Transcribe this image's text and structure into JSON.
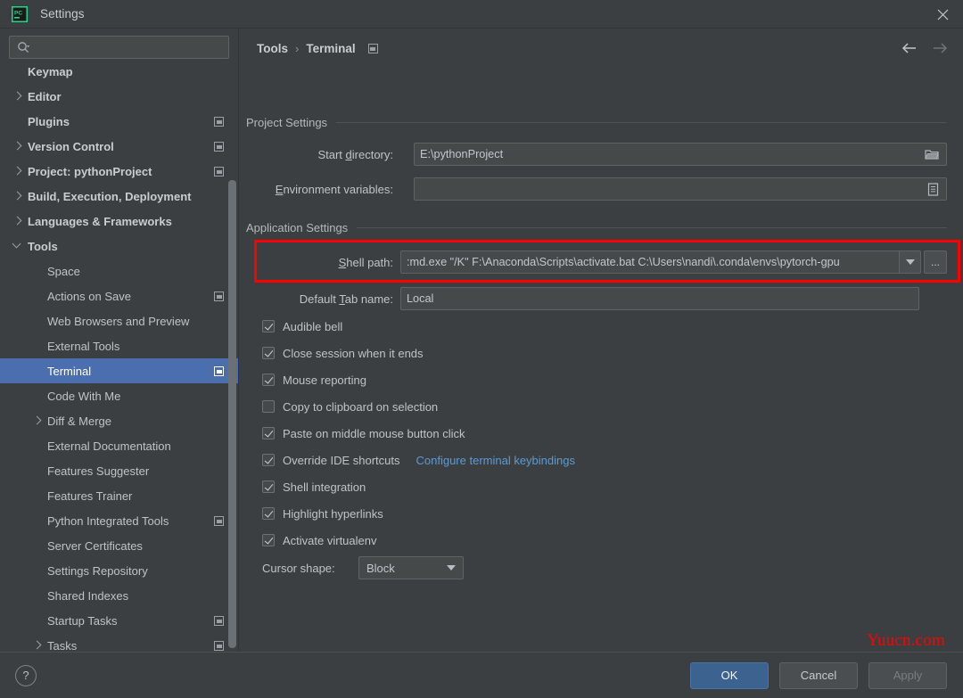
{
  "window": {
    "title": "Settings",
    "logo_icon": "pycharm-logo-icon",
    "close_icon": "close-icon"
  },
  "sidebar": {
    "search": {
      "placeholder": "",
      "value": "",
      "icon": "search-icon"
    },
    "items": [
      {
        "label": "Keymap",
        "level": 1,
        "arrow": "none",
        "bold": true,
        "mark": false,
        "selected": false
      },
      {
        "label": "Editor",
        "level": 1,
        "arrow": "right",
        "bold": true,
        "mark": false,
        "selected": false
      },
      {
        "label": "Plugins",
        "level": 1,
        "arrow": "none",
        "bold": true,
        "mark": true,
        "selected": false
      },
      {
        "label": "Version Control",
        "level": 1,
        "arrow": "right",
        "bold": true,
        "mark": true,
        "selected": false
      },
      {
        "label": "Project: pythonProject",
        "level": 1,
        "arrow": "right",
        "bold": true,
        "mark": true,
        "selected": false
      },
      {
        "label": "Build, Execution, Deployment",
        "level": 1,
        "arrow": "right",
        "bold": true,
        "mark": false,
        "selected": false
      },
      {
        "label": "Languages & Frameworks",
        "level": 1,
        "arrow": "right",
        "bold": true,
        "mark": false,
        "selected": false
      },
      {
        "label": "Tools",
        "level": 1,
        "arrow": "down",
        "bold": true,
        "mark": false,
        "selected": false
      },
      {
        "label": "Space",
        "level": 2,
        "arrow": "none",
        "bold": false,
        "mark": false,
        "selected": false
      },
      {
        "label": "Actions on Save",
        "level": 2,
        "arrow": "none",
        "bold": false,
        "mark": true,
        "selected": false
      },
      {
        "label": "Web Browsers and Preview",
        "level": 2,
        "arrow": "none",
        "bold": false,
        "mark": false,
        "selected": false
      },
      {
        "label": "External Tools",
        "level": 2,
        "arrow": "none",
        "bold": false,
        "mark": false,
        "selected": false
      },
      {
        "label": "Terminal",
        "level": 2,
        "arrow": "none",
        "bold": false,
        "mark": true,
        "selected": true
      },
      {
        "label": "Code With Me",
        "level": 2,
        "arrow": "none",
        "bold": false,
        "mark": false,
        "selected": false
      },
      {
        "label": "Diff & Merge",
        "level": 2,
        "arrow": "right",
        "bold": false,
        "mark": false,
        "selected": false
      },
      {
        "label": "External Documentation",
        "level": 2,
        "arrow": "none",
        "bold": false,
        "mark": false,
        "selected": false
      },
      {
        "label": "Features Suggester",
        "level": 2,
        "arrow": "none",
        "bold": false,
        "mark": false,
        "selected": false
      },
      {
        "label": "Features Trainer",
        "level": 2,
        "arrow": "none",
        "bold": false,
        "mark": false,
        "selected": false
      },
      {
        "label": "Python Integrated Tools",
        "level": 2,
        "arrow": "none",
        "bold": false,
        "mark": true,
        "selected": false
      },
      {
        "label": "Server Certificates",
        "level": 2,
        "arrow": "none",
        "bold": false,
        "mark": false,
        "selected": false
      },
      {
        "label": "Settings Repository",
        "level": 2,
        "arrow": "none",
        "bold": false,
        "mark": false,
        "selected": false
      },
      {
        "label": "Shared Indexes",
        "level": 2,
        "arrow": "none",
        "bold": false,
        "mark": false,
        "selected": false
      },
      {
        "label": "Startup Tasks",
        "level": 2,
        "arrow": "none",
        "bold": false,
        "mark": true,
        "selected": false
      },
      {
        "label": "Tasks",
        "level": 2,
        "arrow": "right",
        "bold": false,
        "mark": true,
        "selected": false
      }
    ]
  },
  "breadcrumb": {
    "parent": "Tools",
    "separator": "›",
    "current": "Terminal",
    "modified_mark_icon": "modified-mark-icon",
    "back_icon": "arrow-left-icon",
    "forward_icon": "arrow-right-icon"
  },
  "main": {
    "project_settings": {
      "title": "Project Settings",
      "start_directory": {
        "label_pre": "Start ",
        "label_accel": "d",
        "label_post": "irectory:",
        "value": "E:\\pythonProject",
        "browse_icon": "folder-icon"
      },
      "environment_variables": {
        "label_pre": "",
        "label_accel": "E",
        "label_post": "nvironment variables:",
        "value": "",
        "browse_icon": "list-edit-icon"
      }
    },
    "application_settings": {
      "title": "Application Settings",
      "shell_path": {
        "label_pre": "",
        "label_accel": "S",
        "label_post": "hell path:",
        "value": ":md.exe \"/K\" F:\\Anaconda\\Scripts\\activate.bat C:\\Users\\nandi\\.conda\\envs\\pytorch-gpu",
        "dropdown_icon": "chevron-down-icon",
        "browse_label": "..."
      },
      "default_tab_name": {
        "label_pre": "Default ",
        "label_accel": "T",
        "label_post": "ab name:",
        "value": "Local"
      },
      "checkboxes": [
        {
          "label": "Audible bell",
          "checked": true
        },
        {
          "label": "Close session when it ends",
          "checked": true
        },
        {
          "label": "Mouse reporting",
          "checked": true
        },
        {
          "label": "Copy to clipboard on selection",
          "checked": false
        },
        {
          "label": "Paste on middle mouse button click",
          "checked": true
        },
        {
          "label": "Override IDE shortcuts",
          "checked": true,
          "link": "Configure terminal keybindings"
        },
        {
          "label": "Shell integration",
          "checked": true
        },
        {
          "label": "Highlight hyperlinks",
          "checked": true
        },
        {
          "label": "Activate virtualenv",
          "checked": true
        }
      ],
      "cursor_shape": {
        "label": "Cursor shape:",
        "value": "Block",
        "dropdown_icon": "chevron-down-icon"
      }
    }
  },
  "footer": {
    "help_label": "?",
    "ok_label": "OK",
    "cancel_label": "Cancel",
    "apply_label": "Apply",
    "watermark": "Yuucn.com"
  },
  "colors": {
    "accent_selection": "#4b6eaf",
    "primary_button": "#3c628f",
    "link": "#5b9bd5",
    "highlight_box": "#fe0000",
    "watermark": "#ff0000",
    "background": "#3c3f41",
    "field_background": "#45494a"
  }
}
